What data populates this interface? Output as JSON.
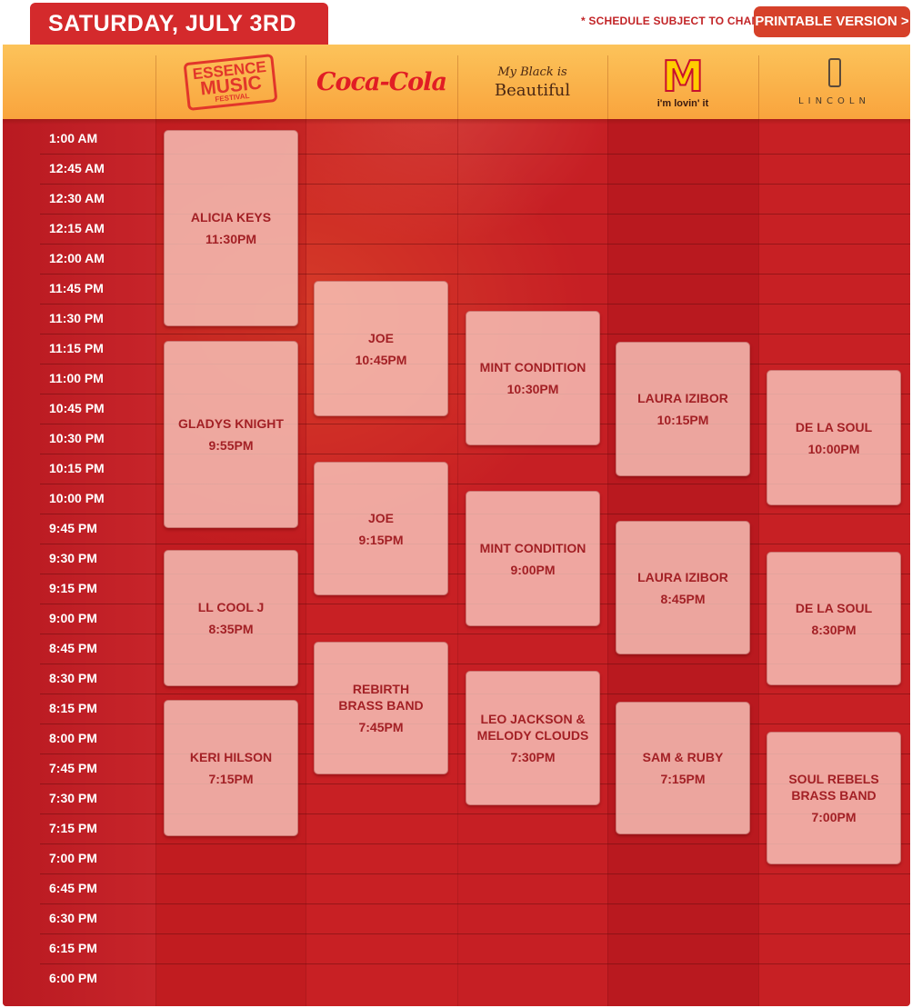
{
  "header": {
    "date_title": "SATURDAY, JULY 3RD",
    "note": "* SCHEDULE SUBJECT TO CHANGE",
    "print_label": "PRINTABLE VERSION >"
  },
  "sponsors": [
    {
      "name": "ESSENCE MUSIC FESTIVAL",
      "logo": [
        "ESSENCE",
        "MUSIC",
        "FESTIVAL"
      ]
    },
    {
      "name": "Coca-Cola",
      "logo": [
        "Coca-Cola"
      ]
    },
    {
      "name": "My Black is Beautiful",
      "logo": [
        "My Black is",
        "Beautiful"
      ]
    },
    {
      "name": "McDonald's",
      "logo": [
        "M",
        "i'm lovin' it"
      ]
    },
    {
      "name": "LINCOLN",
      "logo": [
        "LINCOLN"
      ]
    }
  ],
  "times": [
    "1:00 AM",
    "12:45 AM",
    "12:30 AM",
    "12:15 AM",
    "12:00 AM",
    "11:45 PM",
    "11:30 PM",
    "11:15 PM",
    "11:00 PM",
    "10:45 PM",
    "10:30 PM",
    "10:15 PM",
    "10:00 PM",
    "9:45 PM",
    "9:30 PM",
    "9:15 PM",
    "9:00 PM",
    "8:45 PM",
    "8:30 PM",
    "8:15 PM",
    "8:00 PM",
    "7:45 PM",
    "7:30 PM",
    "7:15 PM",
    "7:00 PM",
    "6:45 PM",
    "6:30 PM",
    "6:15 PM",
    "6:00 PM"
  ],
  "events": [
    {
      "stage": 0,
      "artist": [
        "ALICIA KEYS"
      ],
      "time": "11:30PM"
    },
    {
      "stage": 0,
      "artist": [
        "GLADYS KNIGHT"
      ],
      "time": "9:55PM"
    },
    {
      "stage": 0,
      "artist": [
        "LL COOL J"
      ],
      "time": "8:35PM"
    },
    {
      "stage": 0,
      "artist": [
        "KERI HILSON"
      ],
      "time": "7:15PM"
    },
    {
      "stage": 1,
      "artist": [
        "JOE"
      ],
      "time": "10:45PM"
    },
    {
      "stage": 1,
      "artist": [
        "JOE"
      ],
      "time": "9:15PM"
    },
    {
      "stage": 1,
      "artist": [
        "REBIRTH",
        "BRASS BAND"
      ],
      "time": "7:45PM"
    },
    {
      "stage": 2,
      "artist": [
        "MINT CONDITION"
      ],
      "time": "10:30PM"
    },
    {
      "stage": 2,
      "artist": [
        "MINT CONDITION"
      ],
      "time": "9:00PM"
    },
    {
      "stage": 2,
      "artist": [
        "LEO JACKSON &",
        "MELODY CLOUDS"
      ],
      "time": "7:30PM"
    },
    {
      "stage": 3,
      "artist": [
        "LAURA IZIBOR"
      ],
      "time": "10:15PM"
    },
    {
      "stage": 3,
      "artist": [
        "LAURA IZIBOR"
      ],
      "time": "8:45PM"
    },
    {
      "stage": 3,
      "artist": [
        "SAM & RUBY"
      ],
      "time": "7:15PM"
    },
    {
      "stage": 4,
      "artist": [
        "DE LA SOUL"
      ],
      "time": "10:00PM"
    },
    {
      "stage": 4,
      "artist": [
        "DE LA SOUL"
      ],
      "time": "8:30PM"
    },
    {
      "stage": 4,
      "artist": [
        "SOUL REBELS",
        "BRASS BAND"
      ],
      "time": "7:00PM"
    }
  ],
  "colors": {
    "accent": "#d42a2c",
    "board": "#c51f25",
    "header_gold": "#f9a43d",
    "event_bg": "#f7c3b8",
    "event_text": "#a32025"
  }
}
